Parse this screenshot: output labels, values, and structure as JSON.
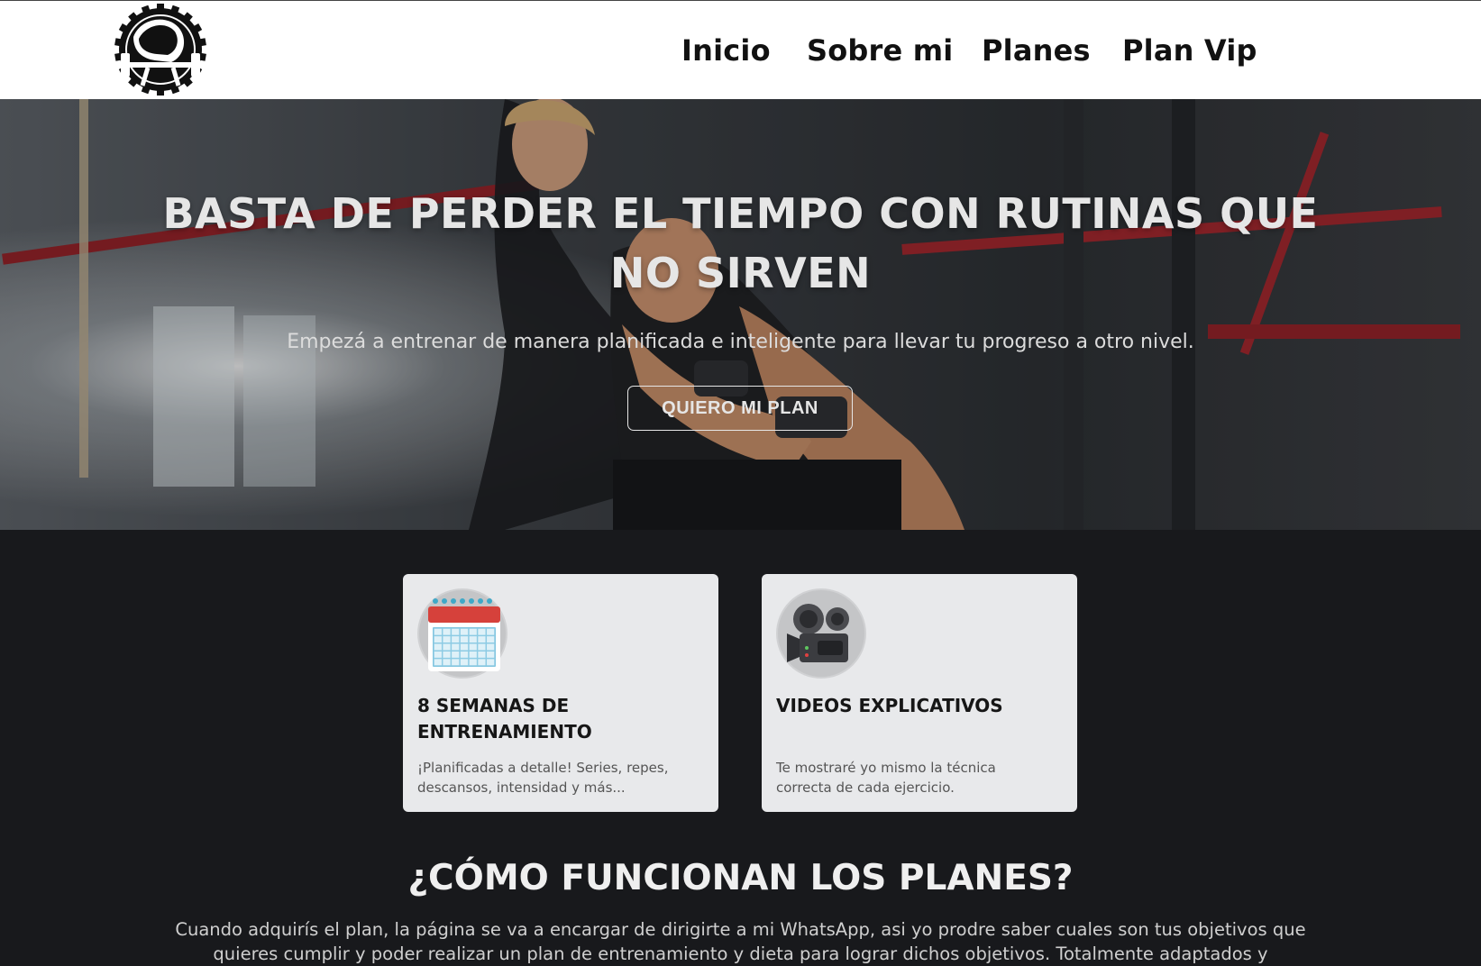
{
  "nav": {
    "logo_alt": "logo",
    "items": [
      "Inicio",
      "Sobre mi",
      "Planes",
      "Plan Vip"
    ]
  },
  "hero": {
    "title": "BASTA DE PERDER EL TIEMPO CON RUTINAS QUE NO SIRVEN",
    "subtitle": "Empezá a entrenar de manera planificada e inteligente para llevar tu progreso a otro nivel.",
    "button": "QUIERO MI PLAN"
  },
  "features": [
    {
      "icon": "calendar-icon",
      "title": "8 SEMANAS DE ENTRENAMIENTO",
      "text": "¡Planificadas a detalle! Series, repes, descansos, intensidad y más..."
    },
    {
      "icon": "movie-camera-icon",
      "title": "VIDEOS EXPLICATIVOS",
      "text": "Te mostraré yo mismo la técnica correcta de cada ejercicio."
    }
  ],
  "how": {
    "title": "¿CÓMO FUNCIONAN LOS PLANES?",
    "text": "Cuando adquirís el plan, la página se va a encargar de dirigirte a mi WhatsApp, asi yo prodre saber cuales son tus objetivos que quieres cumplir y poder realizar un plan de entrenamiento y dieta para lograr dichos objetivos. Totalmente adaptados y"
  },
  "colors": {
    "page_bg": "#18191c",
    "topbar_bg": "#ffffff",
    "card_bg": "#e8e9eb",
    "accent_red": "#b3232a"
  }
}
